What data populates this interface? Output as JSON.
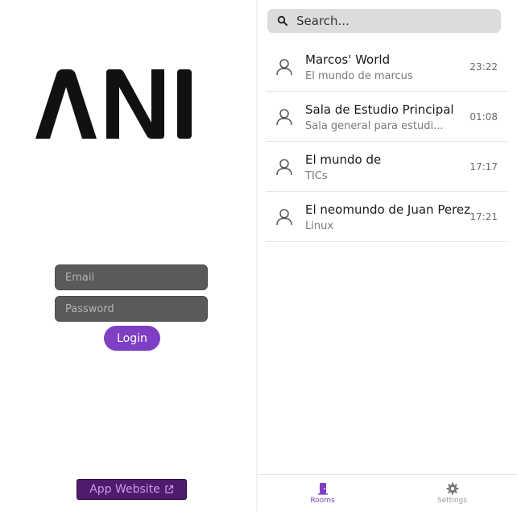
{
  "login": {
    "logo_text": "ANI",
    "email_placeholder": "Email",
    "password_placeholder": "Password",
    "login_label": "Login",
    "website_label": "App Website"
  },
  "rooms_screen": {
    "search_placeholder": "Search...",
    "rooms": [
      {
        "name": "Marcos' World",
        "description": "El mundo de marcus",
        "time": "23:22"
      },
      {
        "name": "Sala de Estudio Principal",
        "description": "Sala general para estudi...",
        "time": "01:08"
      },
      {
        "name": "El mundo de",
        "description": "TICs",
        "time": "17:17"
      },
      {
        "name": "El neomundo de Juan Perez",
        "description": "Linux",
        "time": "17:21"
      }
    ],
    "tabs": [
      {
        "label": "Rooms",
        "icon": "door-icon",
        "active": true
      },
      {
        "label": "Settings",
        "icon": "gear-icon",
        "active": false
      }
    ]
  },
  "colors": {
    "accent": "#7f3fc4",
    "website_button_bg": "#4f1b6b",
    "input_bg": "#5a5a5a"
  }
}
